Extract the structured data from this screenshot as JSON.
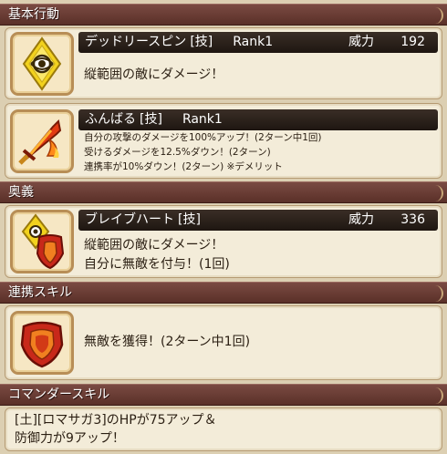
{
  "sections": {
    "basic_action": "基本行動",
    "ougi": "奥義",
    "combo_skill": "連携スキル",
    "commander_skill": "コマンダースキル"
  },
  "skills": [
    {
      "name": "デッドリースピン",
      "tag": "[技]",
      "rank": "Rank1",
      "power_label": "威力",
      "power_value": "192",
      "desc": [
        "縦範囲の敵にダメージ！"
      ]
    },
    {
      "name": "ふんばる",
      "tag": "[技]",
      "rank": "Rank1",
      "desc": [
        "自分の攻撃のダメージを100%アップ！(2ターン中1回)",
        "受けるダメージを12.5%ダウン！(2ターン)",
        "連携率が10%ダウン！(2ターン) ※デメリット"
      ]
    }
  ],
  "ougi": {
    "name": "ブレイブハート",
    "tag": "[技]",
    "power_label": "威力",
    "power_value": "336",
    "desc": [
      "縦範囲の敵にダメージ！",
      "自分に無敵を付与！(1回)"
    ]
  },
  "combo": {
    "desc": "無敵を獲得！(2ターン中1回)"
  },
  "commander": {
    "desc": [
      "[土][ロマサガ3]のHPが75アップ＆",
      "防御力が9アップ！"
    ]
  },
  "icons": {
    "skill1": "yellow-eye-diamond-icon",
    "skill2": "flaming-sword-icon",
    "ougi": "eye-diamond-shield-icon",
    "combo": "red-shield-icon"
  },
  "colors": {
    "header_bar": "#6b3b33",
    "card_bg": "#f3ecd9",
    "title_bar": "#2a201a",
    "page_bg": "#dccfb2"
  }
}
